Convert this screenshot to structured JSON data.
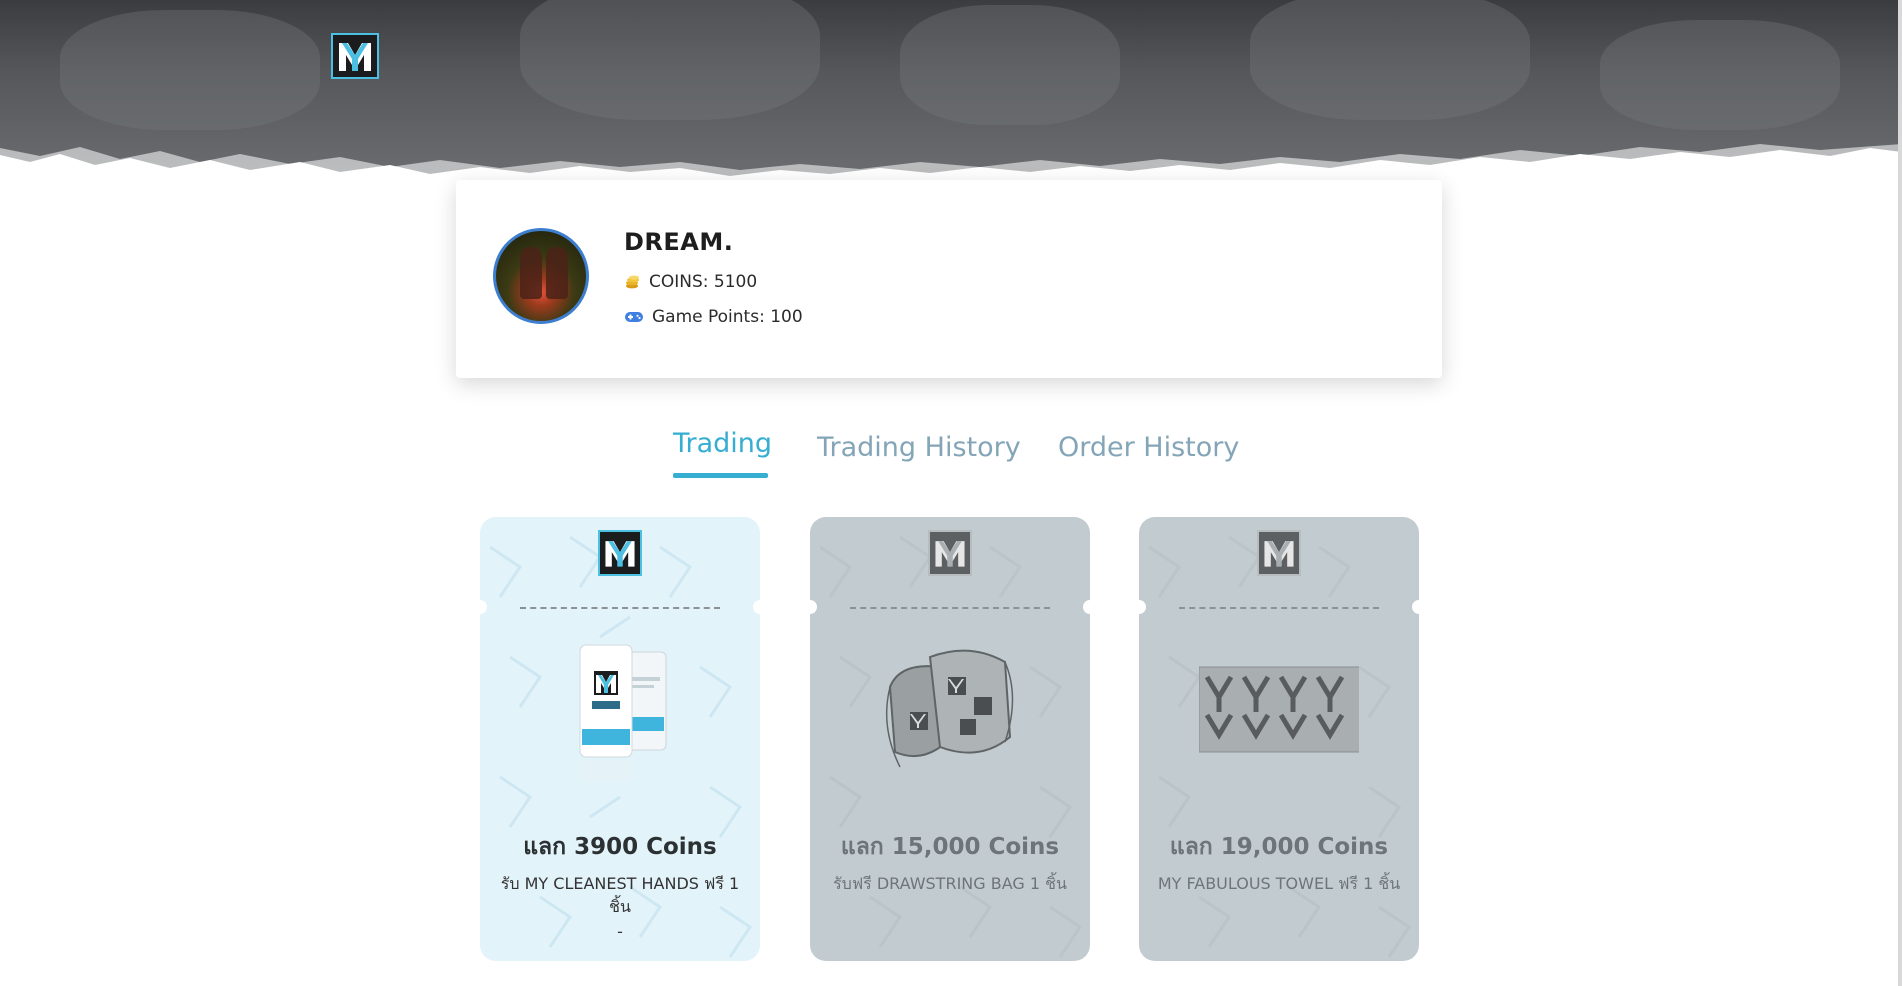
{
  "header": {
    "logo_icon": "my-logo-icon",
    "brand_color": "#4cc0e3"
  },
  "profile": {
    "name": "DREAM.",
    "coins_label": "COINS: 5100",
    "points_label": "Game Points: 100",
    "coins_icon": "coin-stack-icon",
    "points_icon": "gamepad-icon"
  },
  "tabs": [
    {
      "label": "Trading",
      "active": true
    },
    {
      "label": "Trading History",
      "active": false
    },
    {
      "label": "Order History",
      "active": false
    }
  ],
  "colors": {
    "accent": "#35aed2",
    "tab_inactive": "#83a5b7",
    "card_active_bg": "#e3f3fa",
    "card_disabled_bg": "#c2ccd0"
  },
  "cards": [
    {
      "price": "แลก 3900 Coins",
      "desc": "รับ MY CLEANEST HANDS ฟรี 1 ชิ้น",
      "note": "-",
      "available": true,
      "icon": "hand-sanitizer-product-icon"
    },
    {
      "price": "แลก 15,000 Coins",
      "desc": "รับฟรี DRAWSTRING BAG 1 ชิ้น",
      "available": false,
      "icon": "drawstring-bag-product-icon"
    },
    {
      "price": "แลก 19,000 Coins",
      "desc": "MY FABULOUS TOWEL ฟรี 1 ชิ้น",
      "available": false,
      "icon": "towel-product-icon"
    }
  ]
}
